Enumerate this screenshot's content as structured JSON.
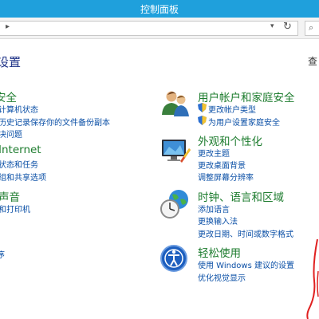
{
  "window": {
    "title": "控制面板"
  },
  "navbar": {
    "search_icon": "search-icon",
    "refresh_icon": "refresh-icon"
  },
  "header": {
    "heading": "设置",
    "view_by": "查"
  },
  "left": {
    "security": {
      "title": "安全",
      "links": [
        "计算机状态",
        "历史记录保存你的文件备份副本",
        "决问题"
      ]
    },
    "network": {
      "title": "Internet",
      "links": [
        "状态和任务",
        "组和共享选项"
      ]
    },
    "hardware": {
      "title": "声音",
      "links": [
        "和打印机"
      ]
    },
    "programs": {
      "link": "序"
    }
  },
  "right": {
    "users": {
      "title": "用户帐户和家庭安全",
      "links": [
        "更改帐户类型",
        "为用户设置家庭安全"
      ],
      "icon": "users-icon"
    },
    "appearance": {
      "title": "外观和个性化",
      "links": [
        "更改主题",
        "更改桌面背景",
        "调整屏幕分辨率"
      ],
      "icon": "appearance-icon"
    },
    "clock": {
      "title": "时钟、语言和区域",
      "links": [
        "添加语言",
        "更换输入法",
        "更改日期、时间或数字格式"
      ],
      "icon": "clock-globe-icon"
    },
    "ease": {
      "title": "轻松使用",
      "links": [
        "使用 Windows 建议的设置",
        "优化视觉显示"
      ],
      "icon": "ease-of-access-icon"
    }
  },
  "colors": {
    "titlebar": "#1fa0dc",
    "category": "#1d7c2e",
    "link": "#0a4fa6",
    "heading": "#1e3287",
    "annotation": "#e02020"
  }
}
